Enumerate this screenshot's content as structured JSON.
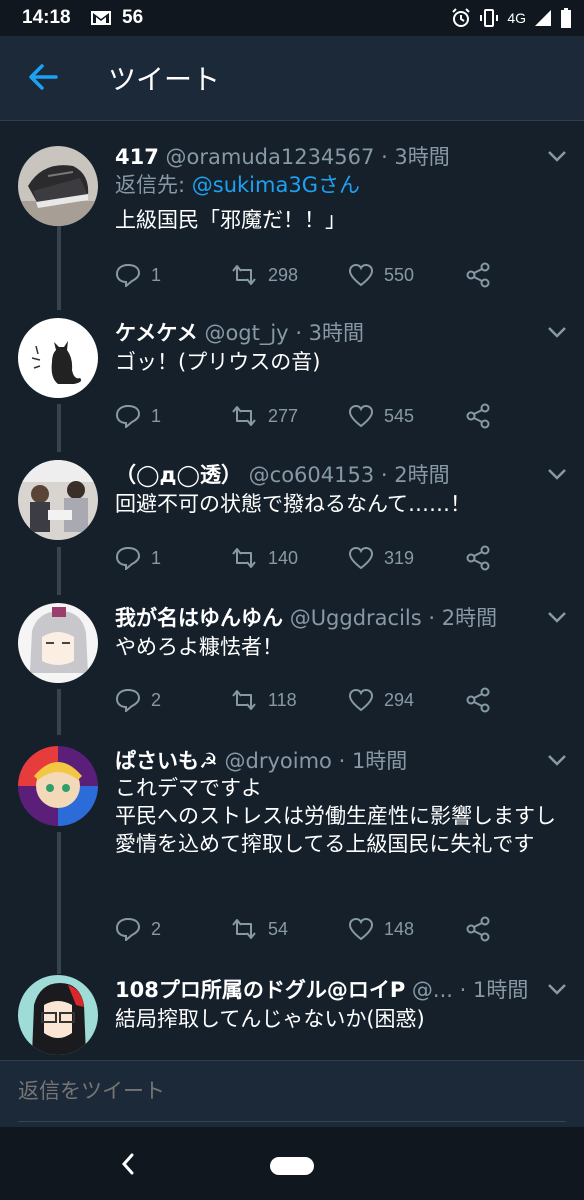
{
  "status_bar": {
    "time": "14:18",
    "notification_count": "56",
    "network": "4G",
    "icons": [
      "gmail-icon",
      "alarm-icon",
      "vibrate-icon",
      "signal-icon",
      "battery-icon"
    ]
  },
  "header": {
    "title": "ツイート",
    "back_icon": "arrow-left-icon"
  },
  "tweets": [
    {
      "name": "417",
      "handle": "@oramuda1234567",
      "time": "· 3時間",
      "reply_to_prefix": "返信先: ",
      "reply_to_user": "@sukima3Gさん",
      "text": "上級国民「邪魔だ！！」",
      "replies": "1",
      "retweets": "298",
      "likes": "550"
    },
    {
      "name": "ケメケメ",
      "handle": "@ogt_jy",
      "time": "· 3時間",
      "text": "ゴッ！(プリウスの音)",
      "replies": "1",
      "retweets": "277",
      "likes": "545"
    },
    {
      "name": "（◯д◯透）",
      "handle": "@co604153",
      "time": "· 2時間",
      "text": "回避不可の状態で撥ねるなんて……！",
      "replies": "1",
      "retweets": "140",
      "likes": "319"
    },
    {
      "name": "我が名はゆんゆん",
      "handle": "@Uggdracils",
      "time": "· 2時間",
      "text": "やめろよ糠怯者！",
      "replies": "2",
      "retweets": "118",
      "likes": "294"
    },
    {
      "name": "ぱさいも☭",
      "handle": "@dryoimo",
      "time": "· 1時間",
      "text": "これデマですよ\n平民へのストレスは労働生産性に影響しますし\n愛情を込めて搾取してる上級国民に失礼です",
      "replies": "2",
      "retweets": "54",
      "likes": "148"
    },
    {
      "name": "108プロ所属のドグル@ロイP",
      "handle": "@...",
      "time": "· 1時間",
      "text": "結局搾取してんじゃないか(困惑)"
    }
  ],
  "reply_bar": {
    "placeholder": "返信をツイート"
  },
  "colors": {
    "background": "#15202b",
    "header_bg": "#1c2938",
    "accent": "#1da1f2",
    "muted_text": "#8899a6"
  }
}
